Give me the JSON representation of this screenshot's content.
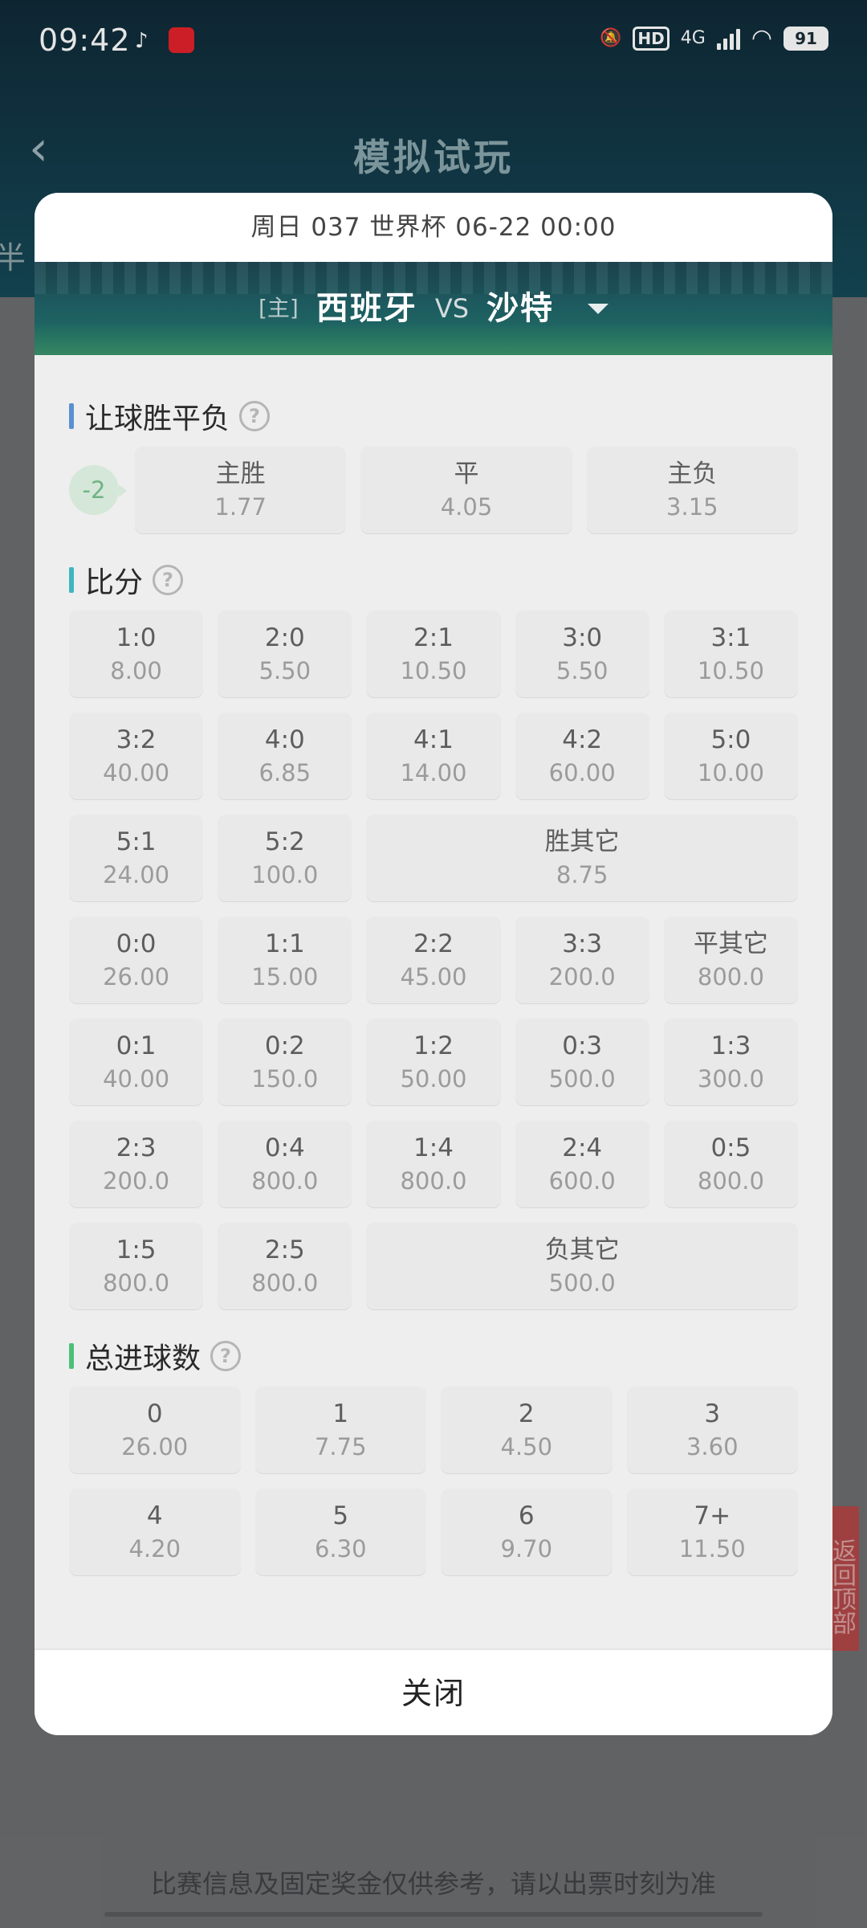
{
  "status_bar": {
    "time": "09:42",
    "network": "4G",
    "battery": "91"
  },
  "background": {
    "title": "模拟试玩",
    "half_label": "半",
    "footer_text": "比赛信息及固定奖金仅供参考，请以出票时刻为准",
    "side_button": "返回顶部"
  },
  "modal": {
    "header": "周日 037 世界杯 06-22 00:00",
    "home_tag": "[主]",
    "home_team": "西班牙",
    "vs": "VS",
    "away_team": "沙特",
    "handicap": {
      "title": "让球胜平负",
      "accent": "#5b8fd0",
      "tag": "-2",
      "options": [
        {
          "label": "主胜",
          "odds": "1.77"
        },
        {
          "label": "平",
          "odds": "4.05"
        },
        {
          "label": "主负",
          "odds": "3.15"
        }
      ]
    },
    "score": {
      "title": "比分",
      "accent": "#3fb6c0",
      "cells": [
        {
          "label": "1:0",
          "odds": "8.00"
        },
        {
          "label": "2:0",
          "odds": "5.50"
        },
        {
          "label": "2:1",
          "odds": "10.50"
        },
        {
          "label": "3:0",
          "odds": "5.50"
        },
        {
          "label": "3:1",
          "odds": "10.50"
        },
        {
          "label": "3:2",
          "odds": "40.00"
        },
        {
          "label": "4:0",
          "odds": "6.85"
        },
        {
          "label": "4:1",
          "odds": "14.00"
        },
        {
          "label": "4:2",
          "odds": "60.00"
        },
        {
          "label": "5:0",
          "odds": "10.00"
        },
        {
          "label": "5:1",
          "odds": "24.00"
        },
        {
          "label": "5:2",
          "odds": "100.0"
        },
        {
          "label": "胜其它",
          "odds": "8.75",
          "wide": true
        },
        {
          "label": "0:0",
          "odds": "26.00"
        },
        {
          "label": "1:1",
          "odds": "15.00"
        },
        {
          "label": "2:2",
          "odds": "45.00"
        },
        {
          "label": "3:3",
          "odds": "200.0"
        },
        {
          "label": "平其它",
          "odds": "800.0"
        },
        {
          "label": "0:1",
          "odds": "40.00"
        },
        {
          "label": "0:2",
          "odds": "150.0"
        },
        {
          "label": "1:2",
          "odds": "50.00"
        },
        {
          "label": "0:3",
          "odds": "500.0"
        },
        {
          "label": "1:3",
          "odds": "300.0"
        },
        {
          "label": "2:3",
          "odds": "200.0"
        },
        {
          "label": "0:4",
          "odds": "800.0"
        },
        {
          "label": "1:4",
          "odds": "800.0"
        },
        {
          "label": "2:4",
          "odds": "600.0"
        },
        {
          "label": "0:5",
          "odds": "800.0"
        },
        {
          "label": "1:5",
          "odds": "800.0"
        },
        {
          "label": "2:5",
          "odds": "800.0"
        },
        {
          "label": "负其它",
          "odds": "500.0",
          "wide": true
        }
      ]
    },
    "total_goals": {
      "title": "总进球数",
      "accent": "#4cbf7a",
      "cells": [
        {
          "label": "0",
          "odds": "26.00"
        },
        {
          "label": "1",
          "odds": "7.75"
        },
        {
          "label": "2",
          "odds": "4.50"
        },
        {
          "label": "3",
          "odds": "3.60"
        },
        {
          "label": "4",
          "odds": "4.20"
        },
        {
          "label": "5",
          "odds": "6.30"
        },
        {
          "label": "6",
          "odds": "9.70"
        },
        {
          "label": "7+",
          "odds": "11.50"
        }
      ]
    },
    "close_label": "关闭"
  }
}
